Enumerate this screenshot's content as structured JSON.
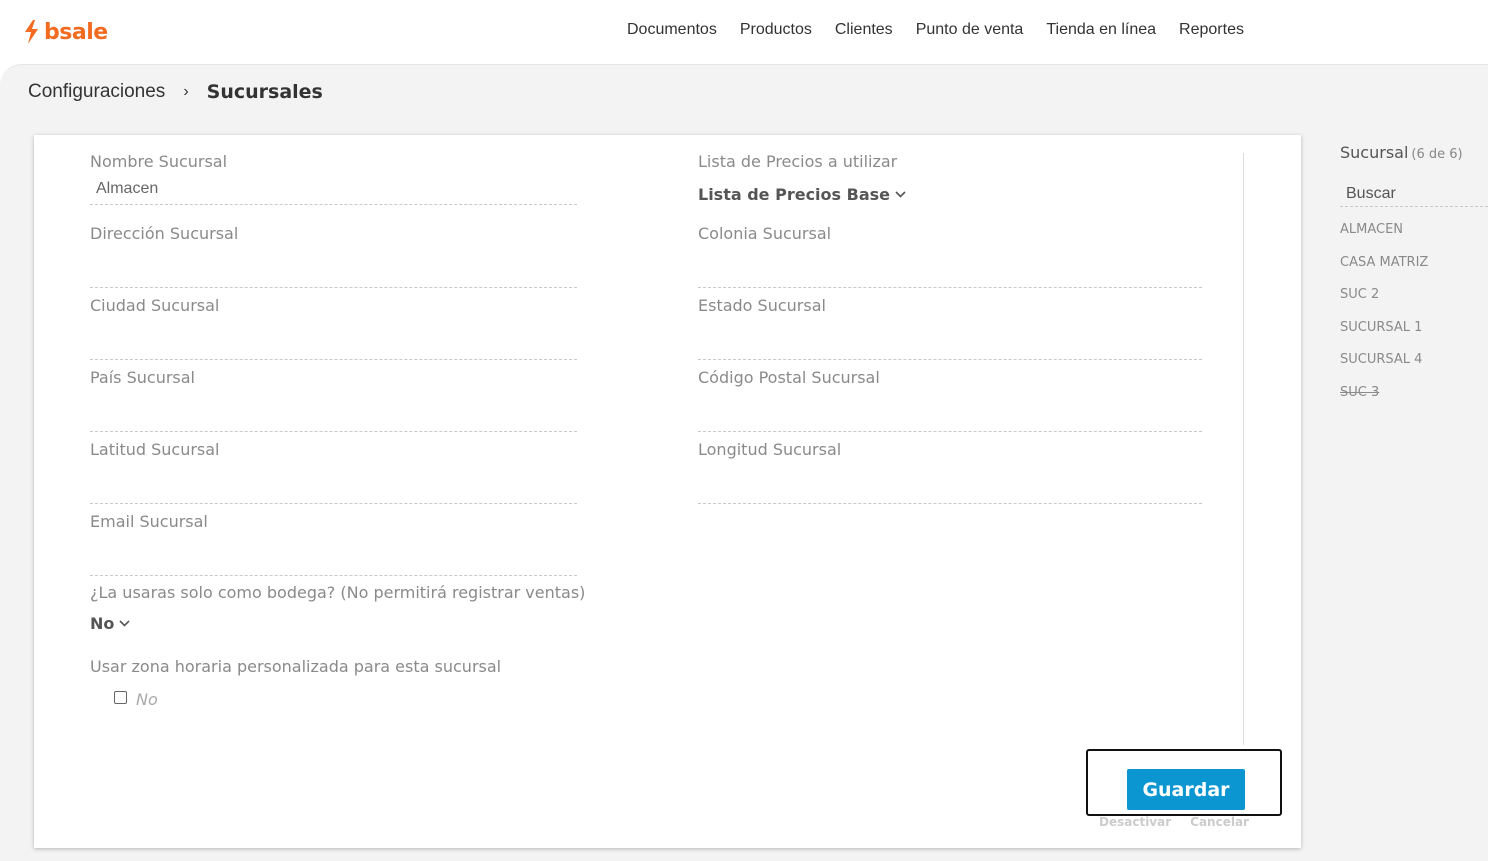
{
  "brand": {
    "name": "bsale",
    "color": "#f26b21"
  },
  "nav": {
    "items": [
      "Documentos",
      "Productos",
      "Clientes",
      "Punto de venta",
      "Tienda en línea",
      "Reportes"
    ]
  },
  "breadcrumb": {
    "parent": "Configuraciones",
    "separator": "›",
    "current": "Sucursales"
  },
  "form": {
    "nombre": {
      "label": "Nombre Sucursal",
      "value": "Almacen"
    },
    "direccion": {
      "label": "Dirección Sucursal",
      "value": ""
    },
    "ciudad": {
      "label": "Ciudad Sucursal",
      "value": ""
    },
    "pais": {
      "label": "País Sucursal",
      "value": ""
    },
    "latitud": {
      "label": "Latitud Sucursal",
      "value": ""
    },
    "email": {
      "label": "Email Sucursal",
      "value": ""
    },
    "lista_precios": {
      "label": "Lista de Precios a utilizar",
      "value": "Lista de Precios Base"
    },
    "colonia": {
      "label": "Colonia Sucursal",
      "value": ""
    },
    "estado": {
      "label": "Estado Sucursal",
      "value": ""
    },
    "codigo_postal": {
      "label": "Código Postal Sucursal",
      "value": ""
    },
    "longitud": {
      "label": "Longitud Sucursal",
      "value": ""
    },
    "bodega": {
      "label": "¿La usaras solo como bodega? (No permitirá registrar ventas)",
      "value": "No"
    },
    "zona_horaria": {
      "label": "Usar zona horaria personalizada para esta sucursal",
      "checkbox_label": "No",
      "checked": false
    }
  },
  "actions": {
    "save": "Guardar",
    "deactivate": "Desactivar",
    "cancel": "Cancelar",
    "save_color": "#0b96d2"
  },
  "sidebar": {
    "title": "Sucursal",
    "count": "(6 de 6)",
    "search_placeholder": "Buscar",
    "items": [
      {
        "label": "ALMACEN",
        "disabled": false
      },
      {
        "label": "CASA MATRIZ",
        "disabled": false
      },
      {
        "label": "SUC 2",
        "disabled": false
      },
      {
        "label": "SUCURSAL 1",
        "disabled": false
      },
      {
        "label": "SUCURSAL 4",
        "disabled": false
      },
      {
        "label": "SUC 3",
        "disabled": true
      }
    ]
  }
}
